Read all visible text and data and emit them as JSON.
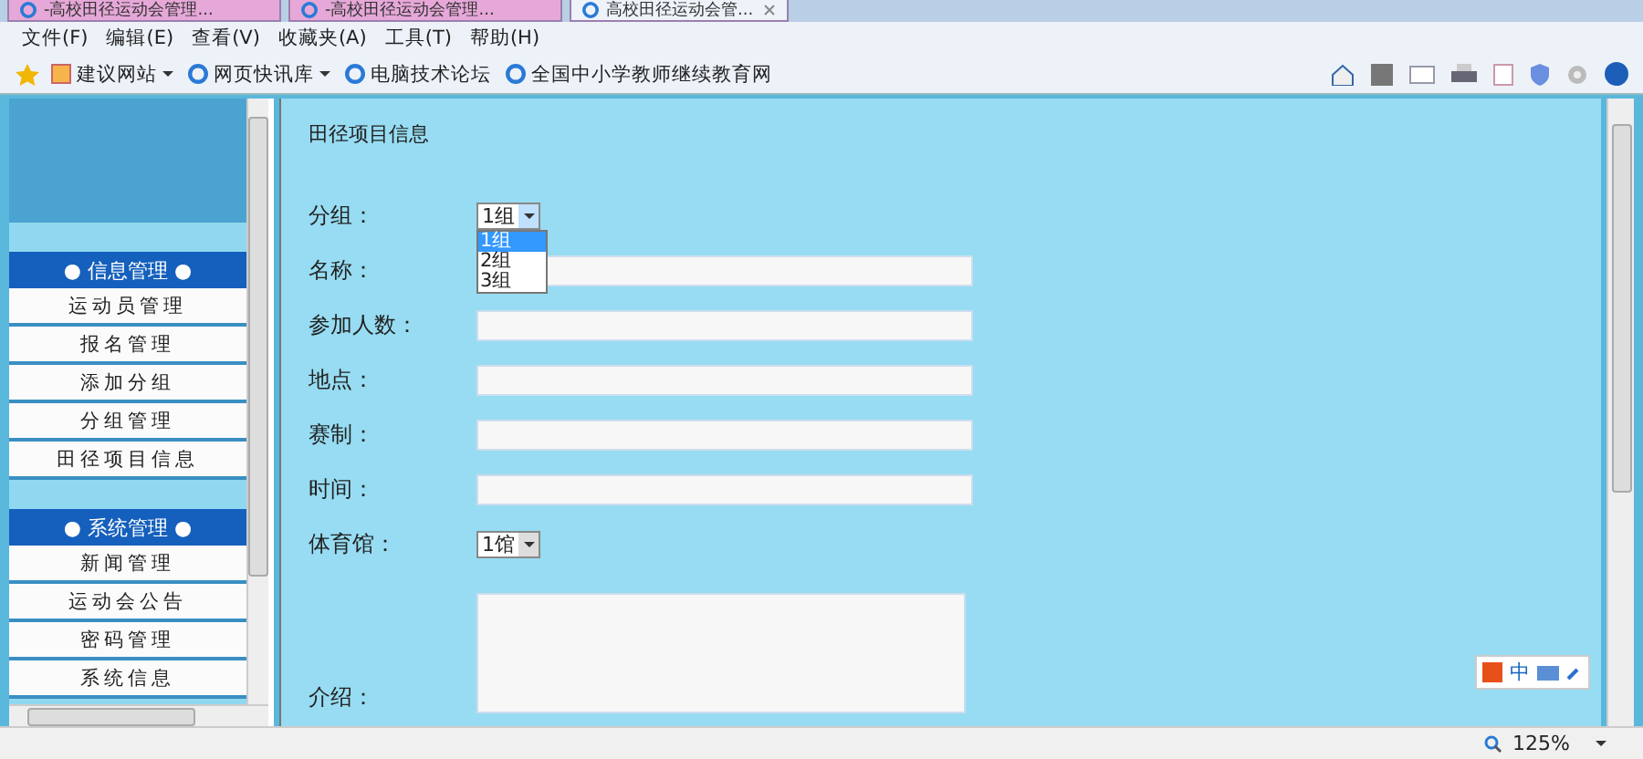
{
  "browser": {
    "tabs": [
      {
        "label": "-高校田径运动会管理...",
        "selected": false,
        "closable": false
      },
      {
        "label": "-高校田径运动会管理...",
        "selected": false,
        "closable": false
      },
      {
        "label": "高校田径运动会管...",
        "selected": true,
        "closable": true
      }
    ],
    "menu": [
      "文件(F)",
      "编辑(E)",
      "查看(V)",
      "收藏夹(A)",
      "工具(T)",
      "帮助(H)"
    ],
    "favorites": [
      {
        "label": "建议网站",
        "dropdown": true
      },
      {
        "label": "网页快讯库",
        "dropdown": true
      },
      {
        "label": "电脑技术论坛",
        "dropdown": false
      },
      {
        "label": "全国中小学教师继续教育网",
        "dropdown": false
      }
    ]
  },
  "sidebar": {
    "sections": [
      {
        "title": "● 信息管理 ●",
        "items": [
          "运动员管理",
          "报名管理",
          "添加分组",
          "分组管理",
          "田径项目信息"
        ]
      },
      {
        "title": "● 系统管理 ●",
        "items": [
          "新闻管理",
          "运动会公告",
          "密码管理",
          "系统信息"
        ]
      }
    ]
  },
  "form": {
    "title": "田径项目信息",
    "fields": [
      {
        "label": "分组：",
        "kind": "select",
        "value": "1组",
        "expanded": true,
        "options": [
          {
            "label": "1组",
            "selected": true
          },
          {
            "label": "2组",
            "selected": false
          },
          {
            "label": "3组",
            "selected": false
          }
        ]
      },
      {
        "label": "名称：",
        "kind": "text"
      },
      {
        "label": "参加人数：",
        "kind": "text"
      },
      {
        "label": "地点：",
        "kind": "text"
      },
      {
        "label": "赛制：",
        "kind": "text"
      },
      {
        "label": "时间：",
        "kind": "text"
      },
      {
        "label": "体育馆：",
        "kind": "select",
        "value": "1馆",
        "expanded": false
      },
      {
        "label": "介绍：",
        "kind": "textarea"
      }
    ]
  },
  "ime": {
    "label": "中"
  },
  "status_bar": {
    "zoom": "125%"
  }
}
